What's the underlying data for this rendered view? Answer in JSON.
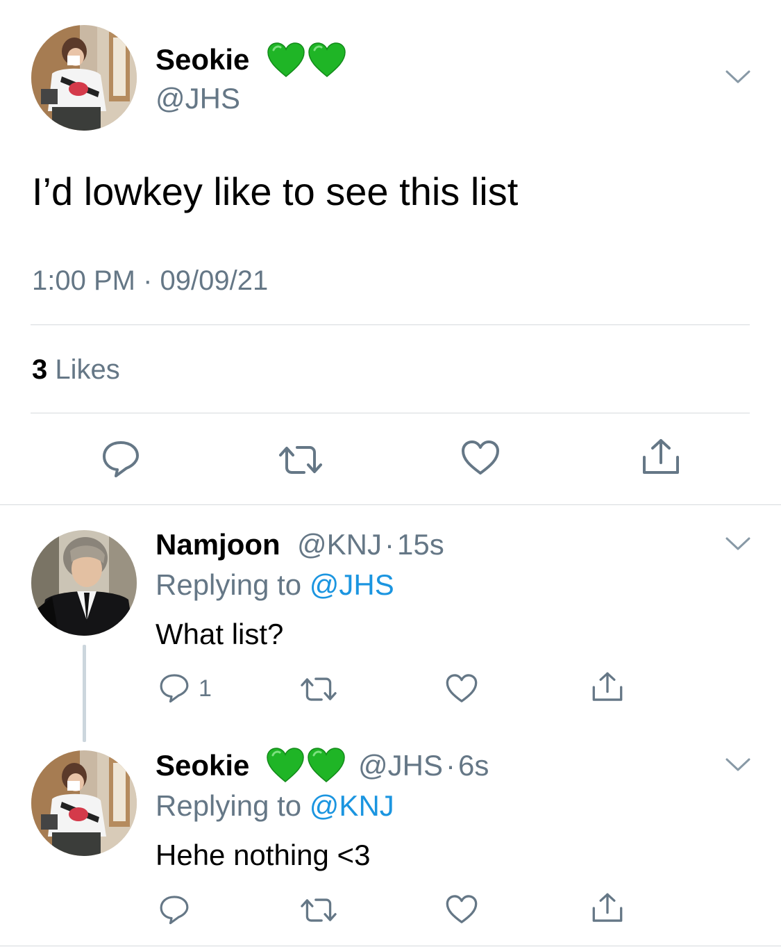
{
  "main_tweet": {
    "author_name": "Seokie",
    "author_handle": "@JHS",
    "name_emojis": [
      "green-heart",
      "green-heart"
    ],
    "text": "I’d lowkey like to see this list",
    "timestamp": "1:00 PM · 09/09/21",
    "likes_count": "3",
    "likes_label": "Likes",
    "actions": [
      "reply",
      "retweet",
      "like",
      "share"
    ]
  },
  "replies": [
    {
      "author_name": "Namjoon",
      "author_handle": "@KNJ",
      "separator": "·",
      "time_ago": "15s",
      "replying_to_label": "Replying to",
      "replying_to_handle": "@JHS",
      "text": "What list?",
      "reply_count": "1"
    },
    {
      "author_name": "Seokie",
      "name_emojis": [
        "green-heart",
        "green-heart"
      ],
      "author_handle": "@JHS",
      "separator": "·",
      "time_ago": "6s",
      "replying_to_label": "Replying to",
      "replying_to_handle": "@KNJ",
      "text": "Hehe nothing <3",
      "reply_count": ""
    }
  ],
  "colors": {
    "secondary_text": "#657786",
    "link": "#1b95e0",
    "emoji_heart": "#20b42a",
    "divider": "#d6dadd",
    "thread_line": "#ccd6dd"
  }
}
